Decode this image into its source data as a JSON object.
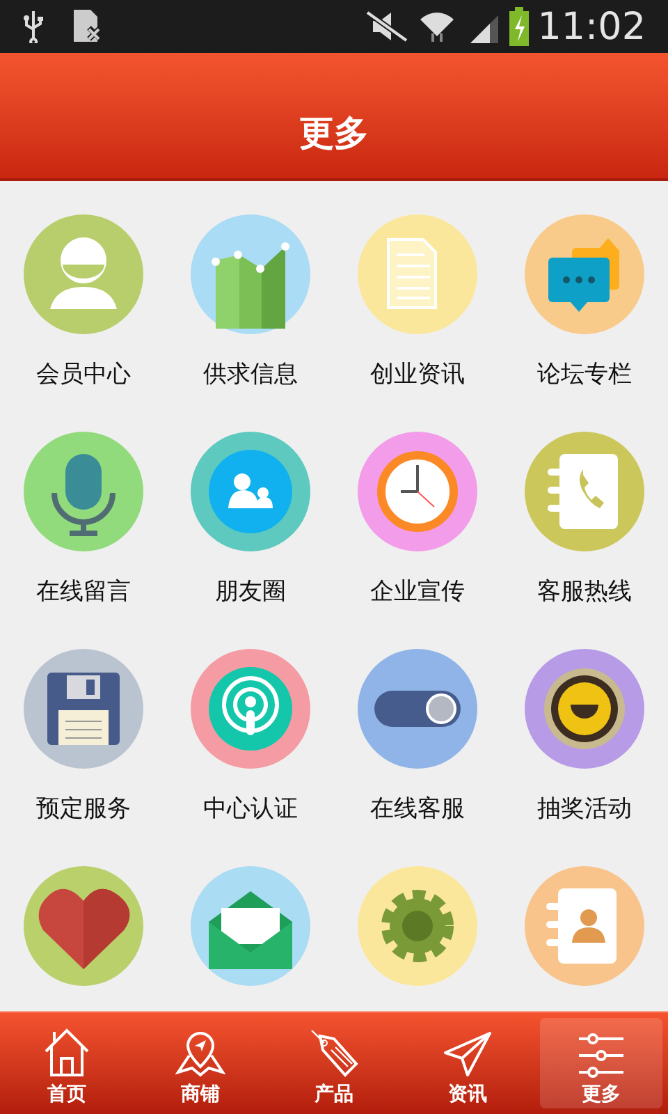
{
  "status_bar": {
    "time": "11:02"
  },
  "header": {
    "title": "更多"
  },
  "grid": [
    {
      "kind": "person",
      "label": "会员中心"
    },
    {
      "kind": "chart",
      "label": "供求信息"
    },
    {
      "kind": "document",
      "label": "创业资讯"
    },
    {
      "kind": "chat",
      "label": "论坛专栏"
    },
    {
      "kind": "mic",
      "label": "在线留言"
    },
    {
      "kind": "friends",
      "label": "朋友圈"
    },
    {
      "kind": "clock",
      "label": "企业宣传"
    },
    {
      "kind": "phonebook",
      "label": "客服热线"
    },
    {
      "kind": "floppy",
      "label": "预定服务"
    },
    {
      "kind": "podcast",
      "label": "中心认证"
    },
    {
      "kind": "toggle",
      "label": "在线客服"
    },
    {
      "kind": "lottery",
      "label": "抽奖活动"
    },
    {
      "kind": "heart"
    },
    {
      "kind": "mail"
    },
    {
      "kind": "gear"
    },
    {
      "kind": "contact"
    }
  ],
  "tab_bar": [
    {
      "kind": "home",
      "label": "首页",
      "selected": false
    },
    {
      "kind": "map",
      "label": "商铺",
      "selected": false
    },
    {
      "kind": "tag",
      "label": "产品",
      "selected": false
    },
    {
      "kind": "send",
      "label": "资讯",
      "selected": false
    },
    {
      "kind": "sliders",
      "label": "更多",
      "selected": true
    }
  ]
}
